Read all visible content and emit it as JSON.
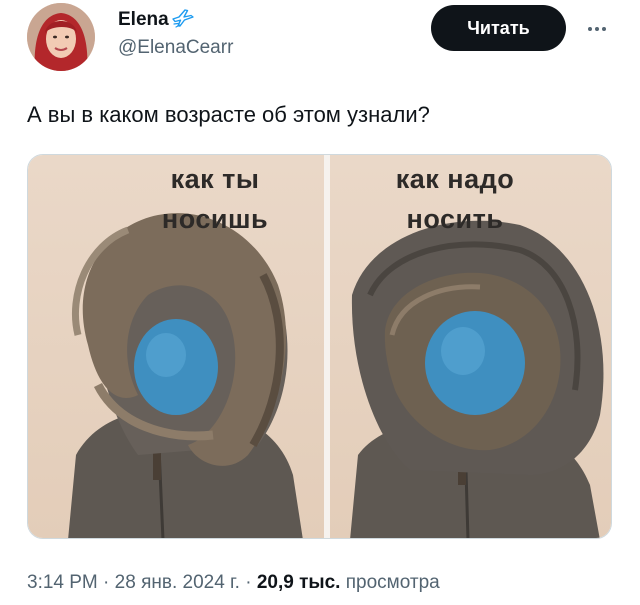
{
  "author": {
    "display_name": "Elena",
    "handle": "@ElenaCearr",
    "badge_icon": "airplane-icon"
  },
  "actions": {
    "follow_label": "Читать",
    "more_icon": "more-dots-icon"
  },
  "tweet": {
    "text": "А вы в каком возрасте об этом узнали?"
  },
  "media": {
    "left_caption_line1": "как ты",
    "left_caption_line2": "носишь",
    "right_caption_line1": "как надо",
    "right_caption_line2": "носить"
  },
  "meta": {
    "time": "3:14 PM",
    "sep1": " · ",
    "date": "28 янв. 2024 г.",
    "sep2": " · ",
    "views_count": "20,9 тыс.",
    "views_label": " просмотра"
  },
  "colors": {
    "accent": "#1d9bf0",
    "text_primary": "#0f1419",
    "text_secondary": "#536471",
    "follow_bg": "#0f1419"
  }
}
